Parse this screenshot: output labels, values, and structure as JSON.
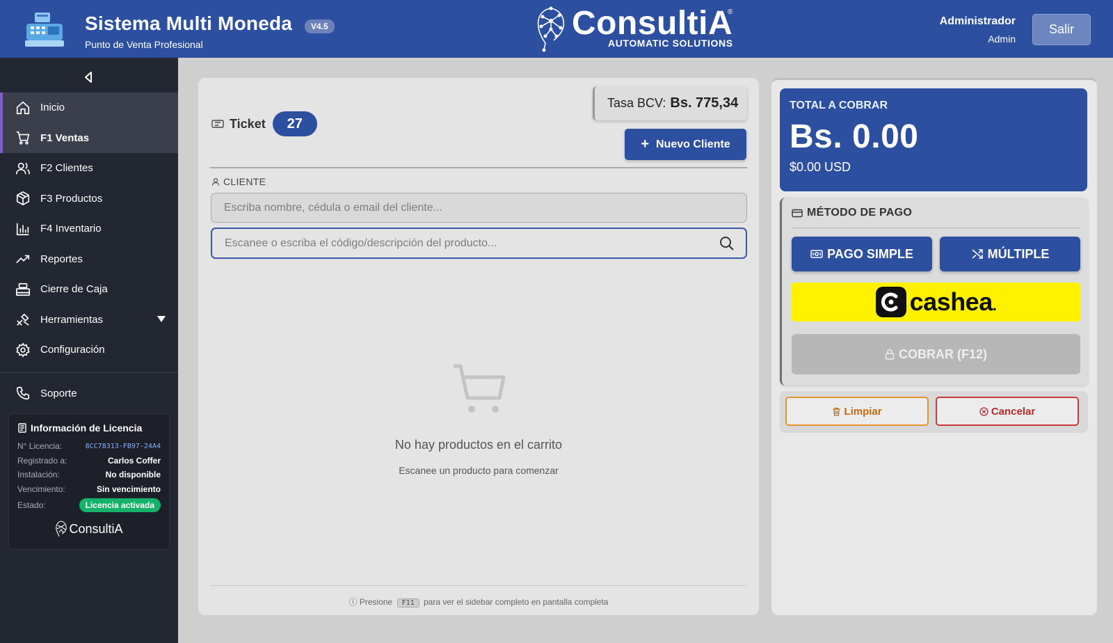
{
  "header": {
    "title": "Sistema Multi Moneda",
    "version": "V4.5",
    "subtitle": "Punto de Venta Profesional",
    "brand_name": "ConsultiA",
    "brand_reg": "®",
    "brand_tagline": "AUTOMATIC SOLUTIONS",
    "user_name": "Administrador",
    "user_role": "Admin",
    "logout_label": "Salir"
  },
  "sidebar": {
    "items": [
      {
        "label": "Inicio",
        "icon": "home-icon"
      },
      {
        "label": "F1 Ventas",
        "icon": "cart-icon"
      },
      {
        "label": "F2 Clientes",
        "icon": "users-icon"
      },
      {
        "label": "F3 Productos",
        "icon": "box-icon"
      },
      {
        "label": "F4 Inventario",
        "icon": "bar-chart-icon"
      },
      {
        "label": "Reportes",
        "icon": "trend-icon"
      },
      {
        "label": "Cierre de Caja",
        "icon": "register-icon"
      },
      {
        "label": "Herramientas",
        "icon": "tools-icon"
      },
      {
        "label": "Configuración",
        "icon": "gear-icon"
      }
    ],
    "support_label": "Soporte",
    "license": {
      "title": "Información de Licencia",
      "rows": [
        {
          "key": "N° Licencia:",
          "value": "8CC78313-FB97-24A4"
        },
        {
          "key": "Registrado a:",
          "value": "Carlos Coffer"
        },
        {
          "key": "Instalación:",
          "value": "No disponible"
        },
        {
          "key": "Vencimiento:",
          "value": "Sin vencimiento"
        },
        {
          "key": "Estado:",
          "value": "Licencia activada"
        }
      ],
      "brand": "ConsultiA"
    }
  },
  "main": {
    "rate_label": "Tasa BCV:",
    "rate_value": "Bs. 775,34",
    "ticket_label": "Ticket",
    "ticket_number": "27",
    "new_client_label": "Nuevo Cliente",
    "client_section_label": "CLIENTE",
    "client_placeholder": "Escriba nombre, cédula o email del cliente...",
    "product_placeholder": "Escanee o escriba el código/descripción del producto...",
    "empty_title": "No hay productos en el carrito",
    "empty_subtitle": "Escanee un producto para comenzar",
    "hint_prefix": "Presione",
    "hint_key": "F11",
    "hint_suffix": "para ver el sidebar completo en pantalla completa"
  },
  "checkout": {
    "total_label": "TOTAL A COBRAR",
    "total_amount": "Bs. 0.00",
    "total_usd": "$0.00 USD",
    "method_title": "MÉTODO DE PAGO",
    "pay_simple_label": "PAGO SIMPLE",
    "pay_multiple_label": "MÚLTIPLE",
    "cashea_label": "cashea",
    "charge_label": "COBRAR (F12)",
    "clear_label": "Limpiar",
    "cancel_label": "Cancelar"
  },
  "colors": {
    "primary": "#2c4fa0",
    "sidebar": "#232731",
    "accent": "#7f5ad7",
    "success": "#17b26a",
    "warning": "#e5932b",
    "danger": "#c83a3a",
    "cashea": "#fff200"
  }
}
